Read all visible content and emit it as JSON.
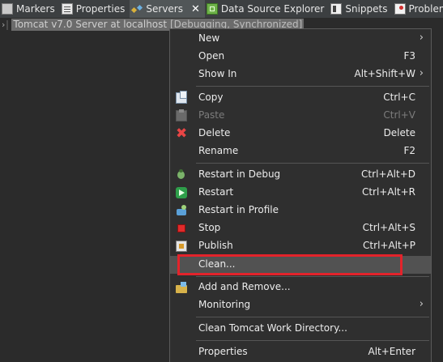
{
  "tabs": [
    {
      "label": "Markers",
      "icon": "markers-icon"
    },
    {
      "label": "Properties",
      "icon": "properties-icon"
    },
    {
      "label": "Servers",
      "icon": "servers-icon",
      "active": true
    },
    {
      "label": "Data Source Explorer",
      "icon": "data-source-explorer-icon"
    },
    {
      "label": "Snippets",
      "icon": "snippets-icon"
    },
    {
      "label": "Problems",
      "icon": "problems-icon"
    }
  ],
  "tree": {
    "server_name": "Tomcat v7.0 Server at localhost",
    "server_status": "[Debugging, Synchronized]"
  },
  "menu": {
    "new": {
      "label": "New"
    },
    "open": {
      "label": "Open",
      "accel": "F3"
    },
    "show_in": {
      "label": "Show In",
      "accel": "Alt+Shift+W"
    },
    "copy": {
      "label": "Copy",
      "accel": "Ctrl+C"
    },
    "paste": {
      "label": "Paste",
      "accel": "Ctrl+V"
    },
    "delete": {
      "label": "Delete",
      "accel": "Delete"
    },
    "rename": {
      "label": "Rename",
      "accel": "F2"
    },
    "restart_debug": {
      "label": "Restart in Debug",
      "accel": "Ctrl+Alt+D"
    },
    "restart": {
      "label": "Restart",
      "accel": "Ctrl+Alt+R"
    },
    "restart_profile": {
      "label": "Restart in Profile"
    },
    "stop": {
      "label": "Stop",
      "accel": "Ctrl+Alt+S"
    },
    "publish": {
      "label": "Publish",
      "accel": "Ctrl+Alt+P"
    },
    "clean": {
      "label": "Clean..."
    },
    "add_remove": {
      "label": "Add and Remove..."
    },
    "monitoring": {
      "label": "Monitoring"
    },
    "clean_work_dir": {
      "label": "Clean Tomcat Work Directory..."
    },
    "properties": {
      "label": "Properties",
      "accel": "Alt+Enter"
    }
  },
  "colors": {
    "background": "#2b2b2b",
    "menu_background": "#2f2f2f",
    "hover": "#525252",
    "highlight_box": "#e3232b"
  }
}
